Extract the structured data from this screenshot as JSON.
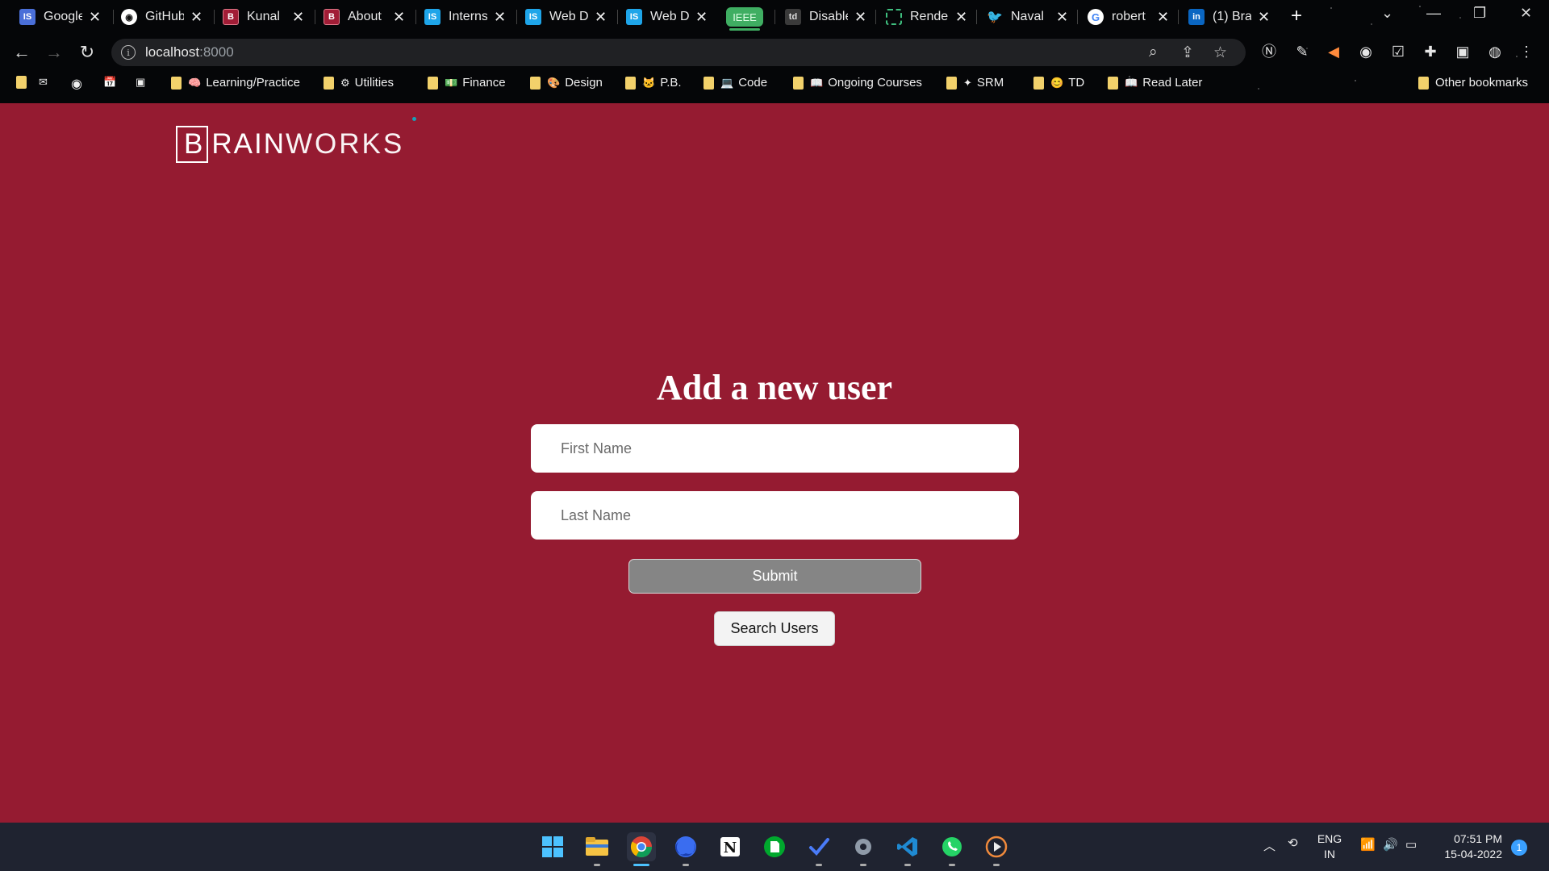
{
  "browser": {
    "tabs": [
      {
        "title": "Google",
        "icon": "google-sheets-icon",
        "color": "#4a6fd8",
        "glyph": "IS"
      },
      {
        "title": "GitHub",
        "icon": "github-icon",
        "color": "#2b2b2b",
        "glyph": "◉"
      },
      {
        "title": "Kunal",
        "icon": "brainworks-icon",
        "color": "#a11d36",
        "glyph": "B"
      },
      {
        "title": "About",
        "icon": "brainworks-icon",
        "color": "#a11d36",
        "glyph": "B"
      },
      {
        "title": "Interns",
        "icon": "internshala-icon",
        "color": "#1ea5e9",
        "glyph": "IS"
      },
      {
        "title": "Web D",
        "icon": "internshala-icon",
        "color": "#1ea5e9",
        "glyph": "IS"
      },
      {
        "title": "Web D",
        "icon": "internshala-icon",
        "color": "#1ea5e9",
        "glyph": "IS"
      }
    ],
    "ieee_tab": "IEEE",
    "tabs_right": [
      {
        "title": "Disable",
        "icon": "td-icon",
        "color": "#444",
        "glyph": "td"
      },
      {
        "title": "Render",
        "icon": "render-icon",
        "color": "#1e9e5a",
        "glyph": "▢"
      },
      {
        "title": "Naval",
        "icon": "twitter-icon",
        "color": "#1d9bf0",
        "glyph": "🐦"
      },
      {
        "title": "robert",
        "icon": "google-icon",
        "color": "#ffffff",
        "glyph": "G"
      },
      {
        "title": "(1) Bra",
        "icon": "linkedin-icon",
        "color": "#0a66c2",
        "glyph": "in"
      }
    ],
    "address": {
      "host": "localhost",
      "port": ":8000"
    },
    "bookmarks": [
      {
        "label": "Learning/Practice",
        "emoji": "🧠"
      },
      {
        "label": "Utilities",
        "emoji": "⚙"
      },
      {
        "label": "Finance",
        "emoji": "💵"
      },
      {
        "label": "Design",
        "emoji": "🎨"
      },
      {
        "label": "P.B.",
        "emoji": "🐱"
      },
      {
        "label": "Code",
        "emoji": "💻"
      },
      {
        "label": "Ongoing Courses",
        "emoji": "📖"
      },
      {
        "label": "SRM",
        "emoji": "✦"
      },
      {
        "label": "TD",
        "emoji": "😊"
      },
      {
        "label": "Read Later",
        "emoji": "📖"
      }
    ],
    "other_bookmarks": "Other bookmarks"
  },
  "page": {
    "logo": {
      "box_letter": "B",
      "rest_bold": "RAIN",
      "rest_light": "WORKS"
    },
    "heading": "Add a new user",
    "first_name_placeholder": "First Name",
    "last_name_placeholder": "Last Name",
    "submit_label": "Submit",
    "search_label": "Search Users"
  },
  "taskbar": {
    "language": "ENG",
    "region": "IN",
    "time": "07:51 PM",
    "date": "15-04-2022",
    "notifications": "1"
  }
}
